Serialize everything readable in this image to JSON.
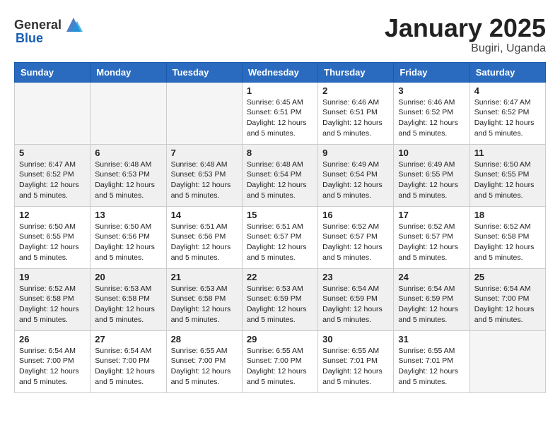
{
  "header": {
    "logo_general": "General",
    "logo_blue": "Blue",
    "month_year": "January 2025",
    "location": "Bugiri, Uganda"
  },
  "weekdays": [
    "Sunday",
    "Monday",
    "Tuesday",
    "Wednesday",
    "Thursday",
    "Friday",
    "Saturday"
  ],
  "weeks": [
    [
      {
        "day": "",
        "info": ""
      },
      {
        "day": "",
        "info": ""
      },
      {
        "day": "",
        "info": ""
      },
      {
        "day": "1",
        "info": "Sunrise: 6:45 AM\nSunset: 6:51 PM\nDaylight: 12 hours\nand 5 minutes."
      },
      {
        "day": "2",
        "info": "Sunrise: 6:46 AM\nSunset: 6:51 PM\nDaylight: 12 hours\nand 5 minutes."
      },
      {
        "day": "3",
        "info": "Sunrise: 6:46 AM\nSunset: 6:52 PM\nDaylight: 12 hours\nand 5 minutes."
      },
      {
        "day": "4",
        "info": "Sunrise: 6:47 AM\nSunset: 6:52 PM\nDaylight: 12 hours\nand 5 minutes."
      }
    ],
    [
      {
        "day": "5",
        "info": "Sunrise: 6:47 AM\nSunset: 6:52 PM\nDaylight: 12 hours\nand 5 minutes."
      },
      {
        "day": "6",
        "info": "Sunrise: 6:48 AM\nSunset: 6:53 PM\nDaylight: 12 hours\nand 5 minutes."
      },
      {
        "day": "7",
        "info": "Sunrise: 6:48 AM\nSunset: 6:53 PM\nDaylight: 12 hours\nand 5 minutes."
      },
      {
        "day": "8",
        "info": "Sunrise: 6:48 AM\nSunset: 6:54 PM\nDaylight: 12 hours\nand 5 minutes."
      },
      {
        "day": "9",
        "info": "Sunrise: 6:49 AM\nSunset: 6:54 PM\nDaylight: 12 hours\nand 5 minutes."
      },
      {
        "day": "10",
        "info": "Sunrise: 6:49 AM\nSunset: 6:55 PM\nDaylight: 12 hours\nand 5 minutes."
      },
      {
        "day": "11",
        "info": "Sunrise: 6:50 AM\nSunset: 6:55 PM\nDaylight: 12 hours\nand 5 minutes."
      }
    ],
    [
      {
        "day": "12",
        "info": "Sunrise: 6:50 AM\nSunset: 6:55 PM\nDaylight: 12 hours\nand 5 minutes."
      },
      {
        "day": "13",
        "info": "Sunrise: 6:50 AM\nSunset: 6:56 PM\nDaylight: 12 hours\nand 5 minutes."
      },
      {
        "day": "14",
        "info": "Sunrise: 6:51 AM\nSunset: 6:56 PM\nDaylight: 12 hours\nand 5 minutes."
      },
      {
        "day": "15",
        "info": "Sunrise: 6:51 AM\nSunset: 6:57 PM\nDaylight: 12 hours\nand 5 minutes."
      },
      {
        "day": "16",
        "info": "Sunrise: 6:52 AM\nSunset: 6:57 PM\nDaylight: 12 hours\nand 5 minutes."
      },
      {
        "day": "17",
        "info": "Sunrise: 6:52 AM\nSunset: 6:57 PM\nDaylight: 12 hours\nand 5 minutes."
      },
      {
        "day": "18",
        "info": "Sunrise: 6:52 AM\nSunset: 6:58 PM\nDaylight: 12 hours\nand 5 minutes."
      }
    ],
    [
      {
        "day": "19",
        "info": "Sunrise: 6:52 AM\nSunset: 6:58 PM\nDaylight: 12 hours\nand 5 minutes."
      },
      {
        "day": "20",
        "info": "Sunrise: 6:53 AM\nSunset: 6:58 PM\nDaylight: 12 hours\nand 5 minutes."
      },
      {
        "day": "21",
        "info": "Sunrise: 6:53 AM\nSunset: 6:58 PM\nDaylight: 12 hours\nand 5 minutes."
      },
      {
        "day": "22",
        "info": "Sunrise: 6:53 AM\nSunset: 6:59 PM\nDaylight: 12 hours\nand 5 minutes."
      },
      {
        "day": "23",
        "info": "Sunrise: 6:54 AM\nSunset: 6:59 PM\nDaylight: 12 hours\nand 5 minutes."
      },
      {
        "day": "24",
        "info": "Sunrise: 6:54 AM\nSunset: 6:59 PM\nDaylight: 12 hours\nand 5 minutes."
      },
      {
        "day": "25",
        "info": "Sunrise: 6:54 AM\nSunset: 7:00 PM\nDaylight: 12 hours\nand 5 minutes."
      }
    ],
    [
      {
        "day": "26",
        "info": "Sunrise: 6:54 AM\nSunset: 7:00 PM\nDaylight: 12 hours\nand 5 minutes."
      },
      {
        "day": "27",
        "info": "Sunrise: 6:54 AM\nSunset: 7:00 PM\nDaylight: 12 hours\nand 5 minutes."
      },
      {
        "day": "28",
        "info": "Sunrise: 6:55 AM\nSunset: 7:00 PM\nDaylight: 12 hours\nand 5 minutes."
      },
      {
        "day": "29",
        "info": "Sunrise: 6:55 AM\nSunset: 7:00 PM\nDaylight: 12 hours\nand 5 minutes."
      },
      {
        "day": "30",
        "info": "Sunrise: 6:55 AM\nSunset: 7:01 PM\nDaylight: 12 hours\nand 5 minutes."
      },
      {
        "day": "31",
        "info": "Sunrise: 6:55 AM\nSunset: 7:01 PM\nDaylight: 12 hours\nand 5 minutes."
      },
      {
        "day": "",
        "info": ""
      }
    ]
  ]
}
